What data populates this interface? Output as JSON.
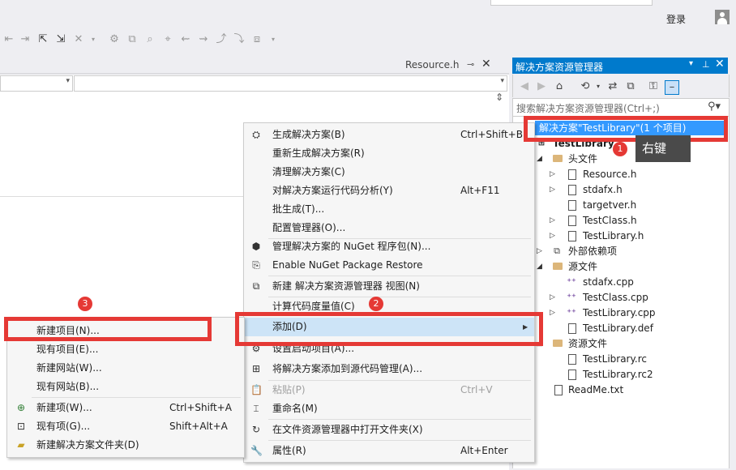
{
  "top": {
    "login": "登录",
    "document_tab": "Resource.h"
  },
  "solution_explorer": {
    "title": "解决方案资源管理器",
    "search_placeholder": "搜索解决方案资源管理器(Ctrl+;)",
    "solution_label": "解决方案\"TestLibrary\"(1 个项目)",
    "project": "TestLibrary",
    "header_folder": "头文件",
    "header_files": [
      "Resource.h",
      "stdafx.h",
      "targetver.h",
      "TestClass.h",
      "TestLibrary.h"
    ],
    "external_deps": "外部依赖项",
    "source_folder": "源文件",
    "source_files": [
      "stdafx.cpp",
      "TestClass.cpp",
      "TestLibrary.cpp",
      "TestLibrary.def"
    ],
    "resource_folder": "资源文件",
    "resource_files": [
      "TestLibrary.rc",
      "TestLibrary.rc2"
    ],
    "readme": "ReadMe.txt"
  },
  "annotations": {
    "step1": "1",
    "step2": "2",
    "step3": "3",
    "right_click": "右键"
  },
  "context_menu": {
    "build": {
      "label": "生成解决方案(B)",
      "shortcut": "Ctrl+Shift+B"
    },
    "rebuild": {
      "label": "重新生成解决方案(R)"
    },
    "clean": {
      "label": "清理解决方案(C)"
    },
    "code_analysis": {
      "label": "对解决方案运行代码分析(Y)",
      "shortcut": "Alt+F11"
    },
    "batch_build": {
      "label": "批生成(T)..."
    },
    "config_manager": {
      "label": "配置管理器(O)..."
    },
    "nuget_manage": {
      "label": "管理解决方案的 NuGet 程序包(N)..."
    },
    "nuget_restore": {
      "label": "Enable NuGet Package Restore"
    },
    "new_view": {
      "label": "新建 解决方案资源管理器 视图(N)"
    },
    "metrics": {
      "label": "计算代码度量值(C)"
    },
    "add": {
      "label": "添加(D)"
    },
    "startup": {
      "label": "设置启动项目(A)..."
    },
    "source_control": {
      "label": "将解决方案添加到源代码管理(A)..."
    },
    "paste": {
      "label": "粘贴(P)",
      "shortcut": "Ctrl+V"
    },
    "rename": {
      "label": "重命名(M)"
    },
    "open_folder": {
      "label": "在文件资源管理器中打开文件夹(X)"
    },
    "properties": {
      "label": "属性(R)",
      "shortcut": "Alt+Enter"
    }
  },
  "add_submenu": {
    "new_project": {
      "label": "新建项目(N)..."
    },
    "existing_project": {
      "label": "现有项目(E)..."
    },
    "new_website": {
      "label": "新建网站(W)..."
    },
    "existing_website": {
      "label": "现有网站(B)..."
    },
    "new_item": {
      "label": "新建项(W)...",
      "shortcut": "Ctrl+Shift+A"
    },
    "existing_item": {
      "label": "现有项(G)...",
      "shortcut": "Shift+Alt+A"
    },
    "new_folder": {
      "label": "新建解决方案文件夹(D)"
    }
  },
  "colors": {
    "accent": "#007acc",
    "selection": "#3399ff",
    "highlight": "#e53935"
  }
}
